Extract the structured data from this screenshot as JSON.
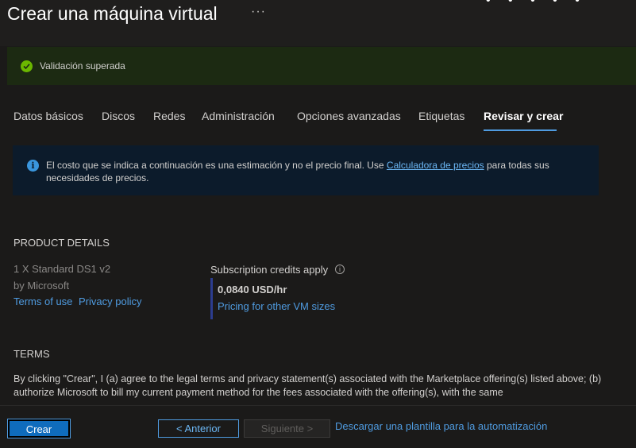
{
  "header": {
    "title": "Crear una máquina virtual",
    "more": "···",
    "top_dots": "• • • • •"
  },
  "validation": {
    "text": "Validación superada"
  },
  "tabs": [
    {
      "label": "Datos básicos",
      "active": false
    },
    {
      "label": "Discos",
      "active": false
    },
    {
      "label": "Redes",
      "active": false
    },
    {
      "label": "Administración",
      "active": false
    },
    {
      "label": "Opciones avanzadas",
      "active": false
    },
    {
      "label": "Etiquetas",
      "active": false
    },
    {
      "label": "Revisar y crear",
      "active": true
    }
  ],
  "info": {
    "text_before": "El costo que se indica a continuación es una estimación y no el precio final. Use ",
    "link": "Calculadora de precios",
    "text_after": " para todas sus necesidades de precios."
  },
  "product": {
    "heading": "PRODUCT DETAILS",
    "name": "1 X Standard DS1 v2",
    "by": "by Microsoft",
    "terms_link": "Terms of use",
    "privacy_link": "Privacy policy",
    "credits_label": "Subscription credits apply",
    "price": "0,0840 USD/hr",
    "pricing_link": "Pricing for other VM sizes"
  },
  "terms": {
    "heading": "TERMS",
    "text": "By clicking \"Crear\", I (a) agree to the legal terms and privacy statement(s) associated with the Marketplace offering(s) listed above; (b) authorize Microsoft to bill my current payment method for the fees associated with the offering(s), with the same"
  },
  "footer": {
    "create": "Crear",
    "previous": "< Anterior",
    "next": "Siguiente >",
    "download": "Descargar una plantilla para la automatización"
  },
  "colors": {
    "accent": "#4f9be0",
    "success": "#6bb700",
    "primary_button": "#0f6cbd"
  }
}
